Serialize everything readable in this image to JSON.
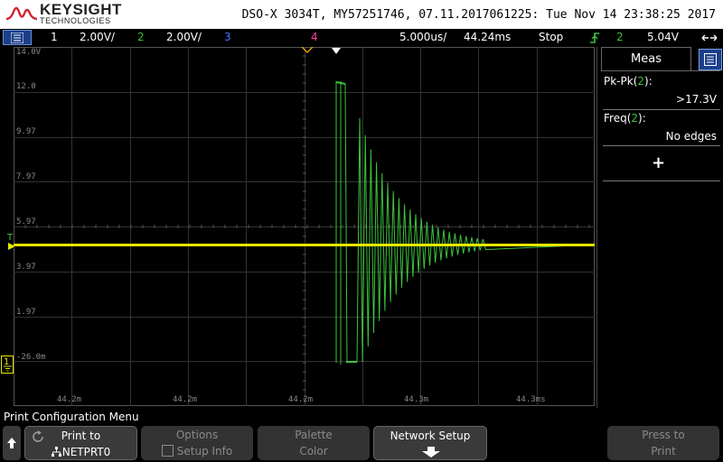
{
  "header": {
    "brand": "KEYSIGHT",
    "brand_sub": "TECHNOLOGIES",
    "title": "DSO-X 3034T, MY57251746, 07.11.2017061225: Tue Nov 14 23:38:25 2017"
  },
  "status": {
    "ch1_num": "1",
    "ch1_scale": "2.00V/",
    "ch2_num": "2",
    "ch2_scale": "2.00V/",
    "ch3_num": "3",
    "ch4_num": "4",
    "timebase": "5.000us/",
    "delay": "44.24ms",
    "run_state": "Stop",
    "trig_channel": "2",
    "trig_level": "5.04V"
  },
  "waveform": {
    "y_labels": [
      "14.0V",
      "12.0",
      "9.97",
      "7.97",
      "5.97",
      "3.97",
      "1.97",
      "-26.0m"
    ],
    "x_labels": [
      "44.2m",
      "44.2m",
      "44.2m",
      "44.3m",
      "44.3ms"
    ],
    "trigger_marker": "T",
    "ground_marker": "1",
    "ch1_color": "#e6e600",
    "ch2_color": "#3cc43c"
  },
  "meas": {
    "tab_label": "Meas",
    "items": [
      {
        "name_pre": "Pk-Pk(",
        "ch": "2",
        "name_post": "):",
        "value": ">17.3V"
      },
      {
        "name_pre": "Freq(",
        "ch": "2",
        "name_post": "):",
        "value": "No edges"
      }
    ],
    "add": "+"
  },
  "menu": {
    "title": "Print Configuration Menu",
    "keys": [
      {
        "l1": "Print to",
        "l2": "NETPRT0"
      },
      {
        "l1": "Options",
        "l2": "Setup Info"
      },
      {
        "l1": "Palette",
        "l2": "Color"
      },
      {
        "l1": "Network Setup",
        "l2": ""
      },
      {
        "l1": "Press to",
        "l2": "Print"
      }
    ]
  }
}
